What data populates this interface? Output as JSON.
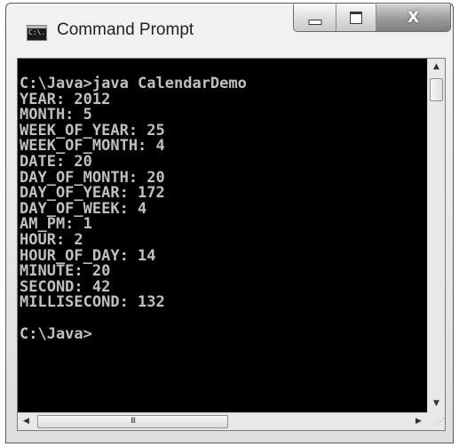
{
  "window": {
    "title": "Command Prompt",
    "icon": "C:\\.",
    "controls": {
      "minimize": "minimize-icon",
      "maximize": "maximize-icon",
      "close": "X"
    }
  },
  "console": {
    "lines": [
      "C:\\Java>java CalendarDemo",
      "YEAR: 2012",
      "MONTH: 5",
      "WEEK_OF_YEAR: 25",
      "WEEK_OF_MONTH: 4",
      "DATE: 20",
      "DAY_OF_MONTH: 20",
      "DAY_OF_YEAR: 172",
      "DAY_OF_WEEK: 4",
      "AM_PM: 1",
      "HOUR: 2",
      "HOUR_OF_DAY: 14",
      "MINUTE: 20",
      "SECOND: 42",
      "MILLISECOND: 132",
      "",
      "C:\\Java>"
    ],
    "text_color": "#c0c0c0",
    "background": "#000000"
  },
  "scrollbars": {
    "up_arrow": "▲",
    "down_arrow": "▼",
    "left_arrow": "◀",
    "right_arrow": "▶",
    "hthumb_grip": "III",
    "resize_grip": "⋰"
  }
}
